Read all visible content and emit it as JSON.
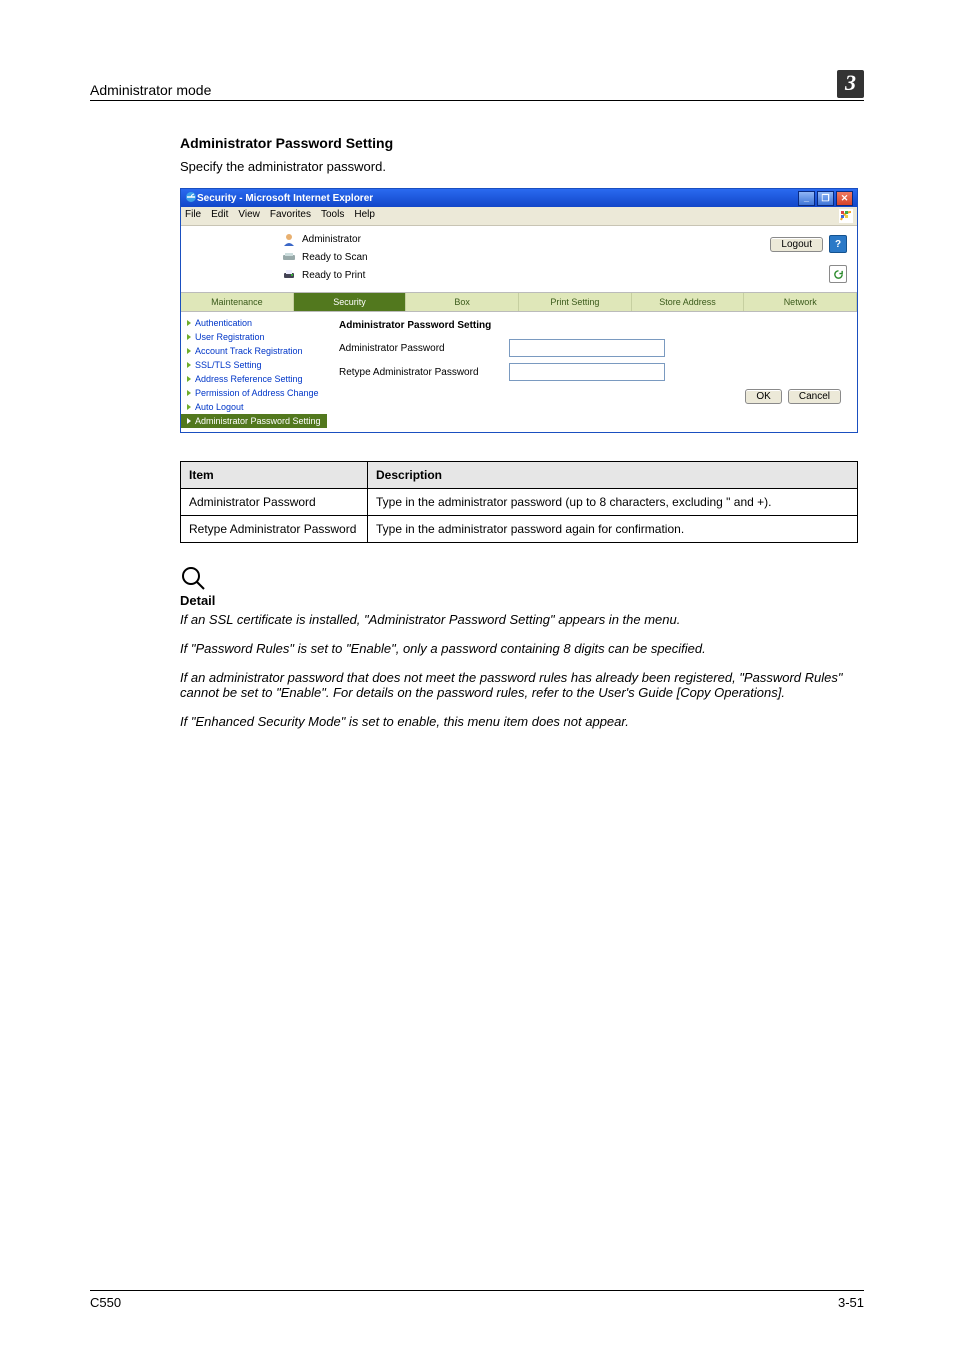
{
  "header": {
    "running": "Administrator mode",
    "chapter": "3"
  },
  "section": {
    "title": "Administrator Password Setting",
    "lead": "Specify the administrator password."
  },
  "shot": {
    "title": "Security - Microsoft Internet Explorer",
    "menus": [
      "File",
      "Edit",
      "View",
      "Favorites",
      "Tools",
      "Help"
    ],
    "admin_label": "Administrator",
    "status": [
      "Ready to Scan",
      "Ready to Print"
    ],
    "logout": "Logout",
    "help": "?",
    "tabs": [
      "Maintenance",
      "Security",
      "Box",
      "Print Setting",
      "Store Address",
      "Network"
    ],
    "active_tab": 1,
    "side": [
      "Authentication",
      "User Registration",
      "Account Track Registration",
      "SSL/TLS Setting",
      "Address Reference Setting",
      "Permission of Address Change",
      "Auto Logout",
      "Administrator Password Setting"
    ],
    "side_selected": 7,
    "form": {
      "title": "Administrator Password Setting",
      "row1": "Administrator Password",
      "row2": "Retype Administrator Password",
      "ok": "OK",
      "cancel": "Cancel"
    }
  },
  "table": {
    "head": [
      "Item",
      "Description"
    ],
    "rows": [
      [
        "Administrator Password",
        "Type in the administrator password (up to 8 characters, excluding \" and +)."
      ],
      [
        "Retype Administrator Password",
        "Type in the administrator password again for confirmation."
      ]
    ]
  },
  "note": {
    "heading": "Detail",
    "paras": [
      "If an SSL certificate is installed, \"Administrator Password Setting\" appears in the menu.",
      "If \"Password Rules\" is set to \"Enable\", only a password containing 8 digits can be specified.",
      "If an administrator password that does not meet the password rules has already been registered, \"Password Rules\" cannot be set to \"Enable\". For details on the password rules, refer to the User's Guide [Copy Operations].",
      "If \"Enhanced Security Mode\" is set to enable, this menu item does not appear."
    ]
  },
  "footer": {
    "left": "C550",
    "right": "3-51"
  }
}
